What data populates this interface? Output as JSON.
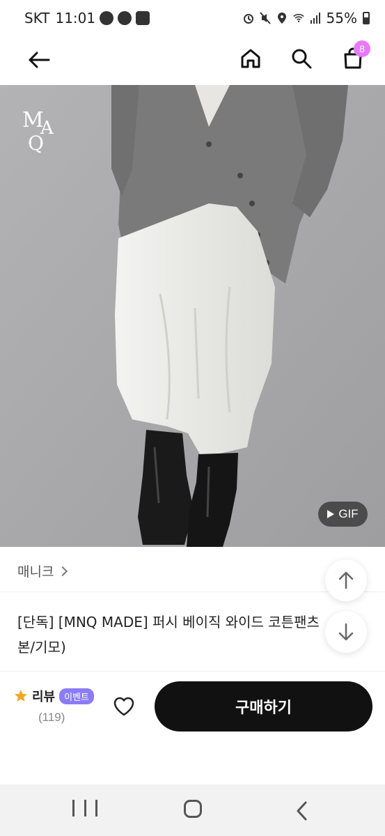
{
  "status_bar": {
    "carrier": "SKT",
    "time": "11:01",
    "battery": "55%"
  },
  "header": {
    "cart_count": "8"
  },
  "product": {
    "brand_logo": "MNQ",
    "gif_label": "GIF",
    "brand_name": "매니크",
    "title_line1": "[단독] [MNQ MADE] 퍼시 베이직 와이드 코튼팬츠",
    "title_line2": "본/기모)"
  },
  "purchase_bar": {
    "review_label": "리뷰",
    "event_badge": "이벤트",
    "review_count": "(119)",
    "buy_label": "구매하기"
  },
  "colors": {
    "cart_badge": "#e879f9",
    "event_badge": "#8b7cf6",
    "buy_button": "#111111",
    "star": "#f5a623"
  }
}
